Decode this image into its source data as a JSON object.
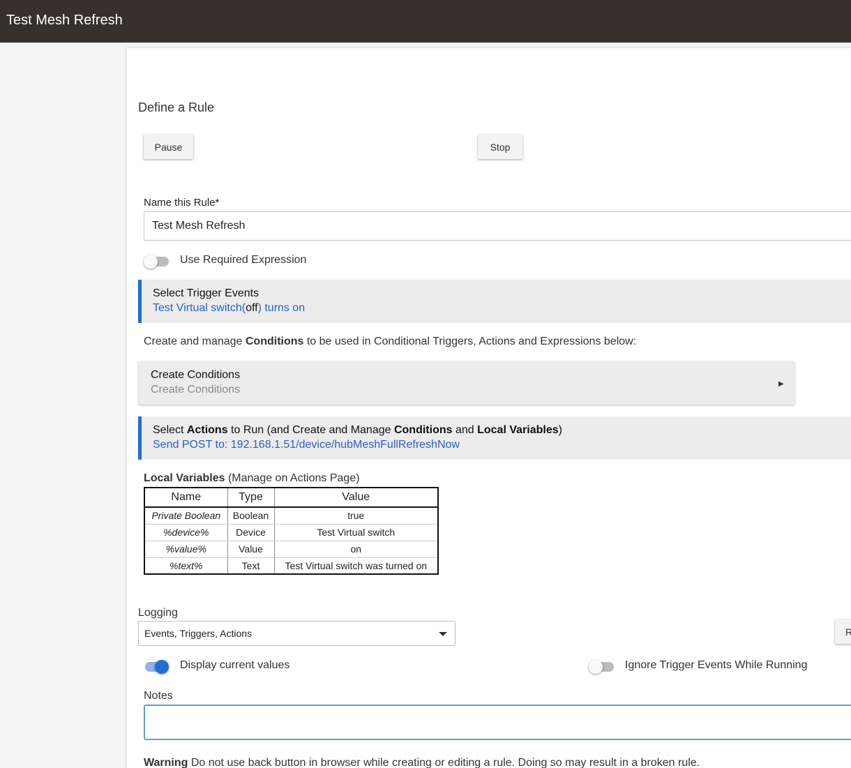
{
  "header": {
    "title": "Test Mesh Refresh"
  },
  "page": {
    "heading": "Define a Rule"
  },
  "buttons": {
    "pause": "Pause",
    "stop": "Stop",
    "right_partial": "R"
  },
  "name_field": {
    "label": "Name this Rule*",
    "value": "Test Mesh Refresh"
  },
  "required_expression": {
    "label": "Use Required Expression",
    "on": false
  },
  "trigger_section": {
    "title": "Select Trigger Events",
    "sub_part1": "Test Virtual switch(",
    "sub_state": "off",
    "sub_part2": ") turns on"
  },
  "conditions_intro": {
    "part1": "Create and manage ",
    "bold": "Conditions",
    "part2": " to be used in Conditional Triggers, Actions and Expressions below:"
  },
  "create_conditions": {
    "title": "Create Conditions",
    "sub": "Create Conditions",
    "icon": "triangle-right-icon"
  },
  "actions_section": {
    "t1": "Select ",
    "t2": "Actions",
    "t3": " to Run (and Create and Manage ",
    "t4": "Conditions",
    "t5": " and ",
    "t6": "Local Variables",
    "t7": ")",
    "sub": "Send POST to: 192.168.1.51/device/hubMeshFullRefreshNow"
  },
  "local_variables": {
    "caption_bold": "Local Variables",
    "caption_rest": " (Manage on Actions Page)",
    "columns": [
      "Name",
      "Type",
      "Value"
    ],
    "rows": [
      {
        "name": "Private Boolean",
        "type": "Boolean",
        "value": "true"
      },
      {
        "name": "%device%",
        "type": "Device",
        "value": "Test Virtual switch"
      },
      {
        "name": "%value%",
        "type": "Value",
        "value": "on"
      },
      {
        "name": "%text%",
        "type": "Text",
        "value": "Test Virtual switch was turned on"
      }
    ]
  },
  "logging": {
    "label": "Logging",
    "selected": "Events, Triggers, Actions"
  },
  "display_values": {
    "label": "Display current values",
    "on": true
  },
  "ignore_trigger": {
    "label": "Ignore Trigger Events While Running",
    "on": false
  },
  "notes": {
    "label": "Notes",
    "value": ""
  },
  "warning": {
    "bold": "Warning",
    "text": " Do not use back button in browser while creating or editing a rule. Doing so may result in a broken rule."
  },
  "colors": {
    "topbar": "#38302c",
    "accent": "#1f6fd1",
    "link": "#2a5fc8"
  }
}
